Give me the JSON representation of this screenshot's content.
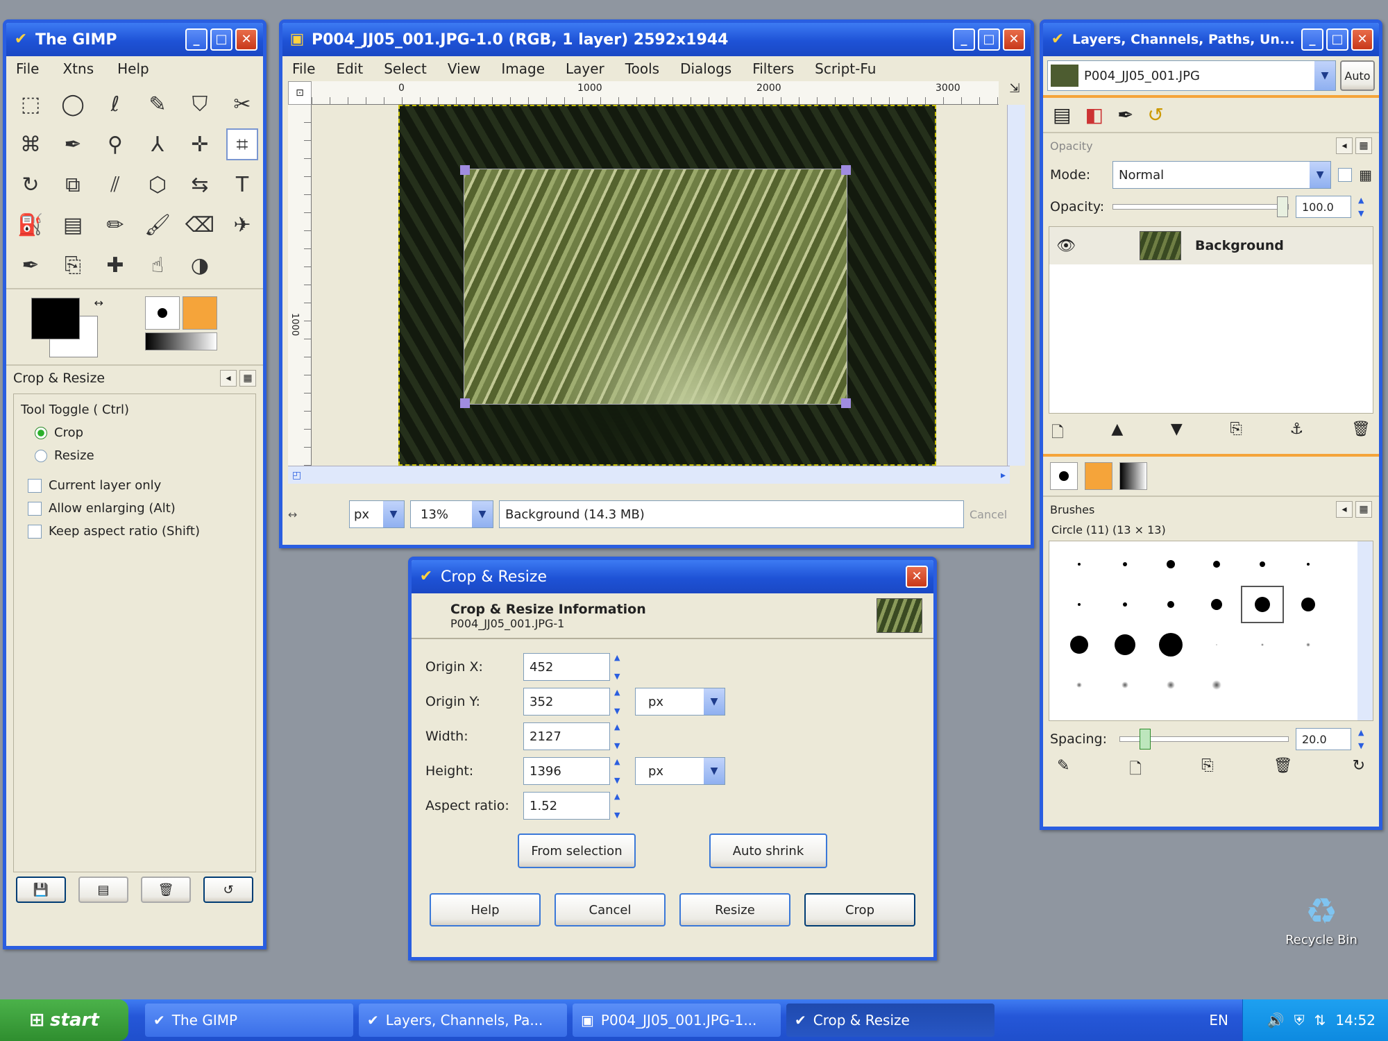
{
  "toolbox": {
    "title": "The GIMP",
    "menu": [
      "File",
      "Xtns",
      "Help"
    ],
    "tools": [
      "rect-select-icon",
      "ellipse-select-icon",
      "lasso-icon",
      "fuzzy-select-icon",
      "color-select-icon",
      "scissors-icon",
      "paths-icon",
      "color-picker-icon",
      "zoom-icon",
      "measure-icon",
      "move-icon",
      "crop-icon",
      "rotate-icon",
      "scale-icon",
      "shear-icon",
      "perspective-icon",
      "flip-icon",
      "text-icon",
      "bucket-fill-icon",
      "blend-icon",
      "pencil-icon",
      "paintbrush-icon",
      "eraser-icon",
      "airbrush-icon",
      "ink-icon",
      "clone-icon",
      "heal-icon",
      "smudge-icon",
      "dodge-icon"
    ],
    "tool_glyphs": [
      "⬚",
      "◯",
      "ℓ",
      "✎",
      "⛉",
      "✂",
      "⌘",
      "✒",
      "⚲",
      "⅄",
      "✛",
      "⌗",
      "↻",
      "⧉",
      "⫽",
      "⬡",
      "⇆",
      "T",
      "⛽",
      "▤",
      "✏",
      "🖌",
      "⌫",
      "✈",
      "✒",
      "⎘",
      "✚",
      "☝",
      "◑"
    ],
    "tool_options": {
      "title": "Crop & Resize",
      "mode_label": "Tool Toggle ( Ctrl)",
      "modes": [
        "Crop",
        "Resize"
      ],
      "checks": [
        "Current layer only",
        "Allow enlarging  (Alt)",
        "Keep aspect ratio  (Shift)"
      ]
    }
  },
  "image_window": {
    "title": "P004_JJ05_001.JPG-1.0 (RGB, 1 layer) 2592x1944",
    "menu": [
      "File",
      "Edit",
      "Select",
      "View",
      "Image",
      "Layer",
      "Tools",
      "Dialogs",
      "Filters",
      "Script-Fu"
    ],
    "ruler_labels": [
      "0",
      "1000",
      "2000",
      "3000"
    ],
    "ruler_side_labels": [
      "1000"
    ],
    "status": {
      "units": "px",
      "zoom": "13%",
      "message": "Background (14.3 MB)",
      "cancel": "Cancel"
    }
  },
  "layers": {
    "title": "Layers, Channels, Paths, Un...",
    "image_combo": "P004_JJ05_001.JPG",
    "auto": "Auto",
    "opacity_heading": "Opacity",
    "mode_label": "Mode:",
    "mode_value": "Normal",
    "opacity_label": "Opacity:",
    "opacity_value": "100.0",
    "opacity_fraction": 1.0,
    "layer_name": "Background"
  },
  "brushes": {
    "title": "Brushes",
    "brush_name": "Circle (11) (13 × 13)",
    "spacing_label": "Spacing:",
    "spacing_value": "20.0",
    "spacing_fraction": 0.15,
    "brush_sizes": [
      4,
      6,
      12,
      10,
      8,
      4,
      4,
      6,
      10,
      16,
      22,
      20,
      26,
      30,
      34,
      2,
      4,
      6,
      8,
      10,
      12,
      14
    ]
  },
  "crop_dialog": {
    "title": "Crop & Resize",
    "heading": "Crop & Resize Information",
    "subheading": "P004_JJ05_001.JPG-1",
    "fields": [
      {
        "label": "Origin X:",
        "value": "452"
      },
      {
        "label": "Origin Y:",
        "value": "352"
      },
      {
        "label": "Width:",
        "value": "2127"
      },
      {
        "label": "Height:",
        "value": "1396"
      },
      {
        "label": "Aspect ratio:",
        "value": "1.52"
      }
    ],
    "unit": "px",
    "from_selection": "From selection",
    "auto_shrink": "Auto shrink",
    "buttons": [
      "Help",
      "Cancel",
      "Resize",
      "Crop"
    ]
  },
  "desktop": {
    "recycle_bin": "Recycle Bin"
  },
  "taskbar": {
    "start": "start",
    "tasks": [
      "The GIMP",
      "Layers, Channels, Pa...",
      "P004_JJ05_001.JPG-1...",
      "Crop & Resize"
    ],
    "lang": "EN",
    "clock": "14:52"
  },
  "colors": {
    "xp_blue": "#2a5ee0",
    "fg_color": "#000000",
    "bg_color": "#ffffff",
    "orange": "#f5a43a"
  }
}
